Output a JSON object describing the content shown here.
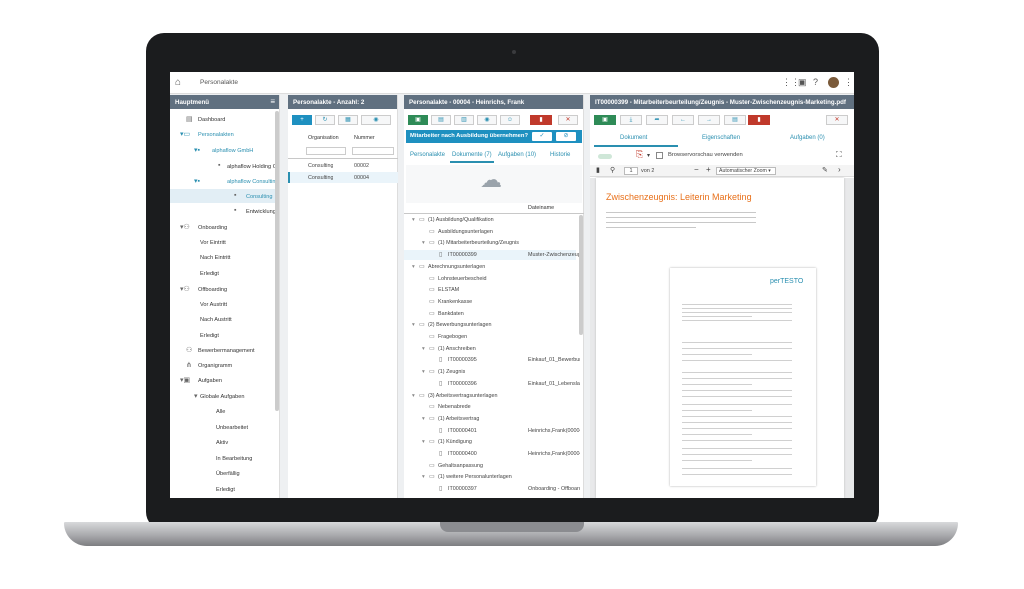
{
  "topbar": {
    "title": "Personalakte"
  },
  "menu": {
    "header": "Hauptmenü",
    "items": [
      {
        "label": "Dashboard"
      },
      {
        "label": "Personalakten"
      },
      {
        "label": "alphaflow GmbH"
      },
      {
        "label": "alphaflow Holding Gr"
      },
      {
        "label": "alphaflow Consulting"
      },
      {
        "label": "Consulting"
      },
      {
        "label": "Entwicklung"
      },
      {
        "label": "Onboarding"
      },
      {
        "label": "Vor Eintritt"
      },
      {
        "label": "Nach Eintritt"
      },
      {
        "label": "Erledigt"
      },
      {
        "label": "Offboarding"
      },
      {
        "label": "Vor Austritt"
      },
      {
        "label": "Nach Austritt"
      },
      {
        "label": "Erledigt"
      },
      {
        "label": "Bewerbermanagement"
      },
      {
        "label": "Organigramm"
      },
      {
        "label": "Aufgaben"
      },
      {
        "label": "Globale Aufgaben"
      },
      {
        "label": "Alle"
      },
      {
        "label": "Unbearbeitet"
      },
      {
        "label": "Aktiv"
      },
      {
        "label": "In Bearbeitung"
      },
      {
        "label": "Überfällig"
      },
      {
        "label": "Erledigt"
      }
    ]
  },
  "list": {
    "header": "Personalakte - Anzahl: 2",
    "col_org": "Organisation",
    "col_num": "Nummer",
    "rows": [
      {
        "org": "Consulting",
        "num": "00002"
      },
      {
        "org": "Consulting",
        "num": "00004"
      }
    ]
  },
  "detail": {
    "header": "Personalakte - 00004 - Heinrichs, Frank",
    "banner": "Mitarbeiter nach Ausbildung übernehmen?",
    "tabs": [
      "Personalakte",
      "Dokumente (7)",
      "Aufgaben (10)",
      "Historie"
    ],
    "col_name": "Dateiname",
    "tree": [
      {
        "label": "(1) Ausbildung/Qualifikation",
        "name": ""
      },
      {
        "label": "Ausbildungsunterlagen",
        "name": ""
      },
      {
        "label": "(1) Mitarbeiterbeurteilung/Zeugnis",
        "name": ""
      },
      {
        "label": "IT00000399",
        "name": "Muster-Zwischenzeugni"
      },
      {
        "label": "Abrechnungsunterlagen",
        "name": ""
      },
      {
        "label": "Lohnsteuerbescheid",
        "name": ""
      },
      {
        "label": "ELSTAM",
        "name": ""
      },
      {
        "label": "Krankenkasse",
        "name": ""
      },
      {
        "label": "Bankdaten",
        "name": ""
      },
      {
        "label": "(2) Bewerbungsunterlagen",
        "name": ""
      },
      {
        "label": "Fragebogen",
        "name": ""
      },
      {
        "label": "(1) Anschreiben",
        "name": ""
      },
      {
        "label": "IT00000395",
        "name": "Einkauf_01_Bewerbung."
      },
      {
        "label": "(1) Zeugnis",
        "name": ""
      },
      {
        "label": "IT00000396",
        "name": "Einkauf_01_Lebenslauf."
      },
      {
        "label": "(3) Arbeitsvertragsunterlagen",
        "name": ""
      },
      {
        "label": "Nebenabrede",
        "name": ""
      },
      {
        "label": "(1) Arbeitsvertrag",
        "name": ""
      },
      {
        "label": "IT00000401",
        "name": "Heinrichs,Frank(00004)"
      },
      {
        "label": "(1) Kündigung",
        "name": ""
      },
      {
        "label": "IT00000400",
        "name": "Heinrichs,Frank(00004)"
      },
      {
        "label": "Gehaltsanpassung",
        "name": ""
      },
      {
        "label": "(1) weitere Personalunterlagen",
        "name": ""
      },
      {
        "label": "IT00000397",
        "name": "Onboarding - Offboarding"
      }
    ]
  },
  "viewer": {
    "header": "IT00000399 - Mitarbeiterbeurteilung/Zeugnis - Muster-Zwischenzeugnis-Marketing.pdf",
    "tabs": [
      "Dokument",
      "Eigenschaften",
      "Aufgaben (0)"
    ],
    "browser_preview": "Browservorschau verwenden",
    "page_num": "1",
    "page_of": "von 2",
    "zoom": "Automatischer Zoom",
    "doc_title": "Zwischenzeugnis: Leiterin Marketing",
    "doc_brand": "perTESTO"
  },
  "colors": {
    "accent": "#2a8fb0",
    "header": "#607080",
    "title_orange": "#e8701a"
  }
}
